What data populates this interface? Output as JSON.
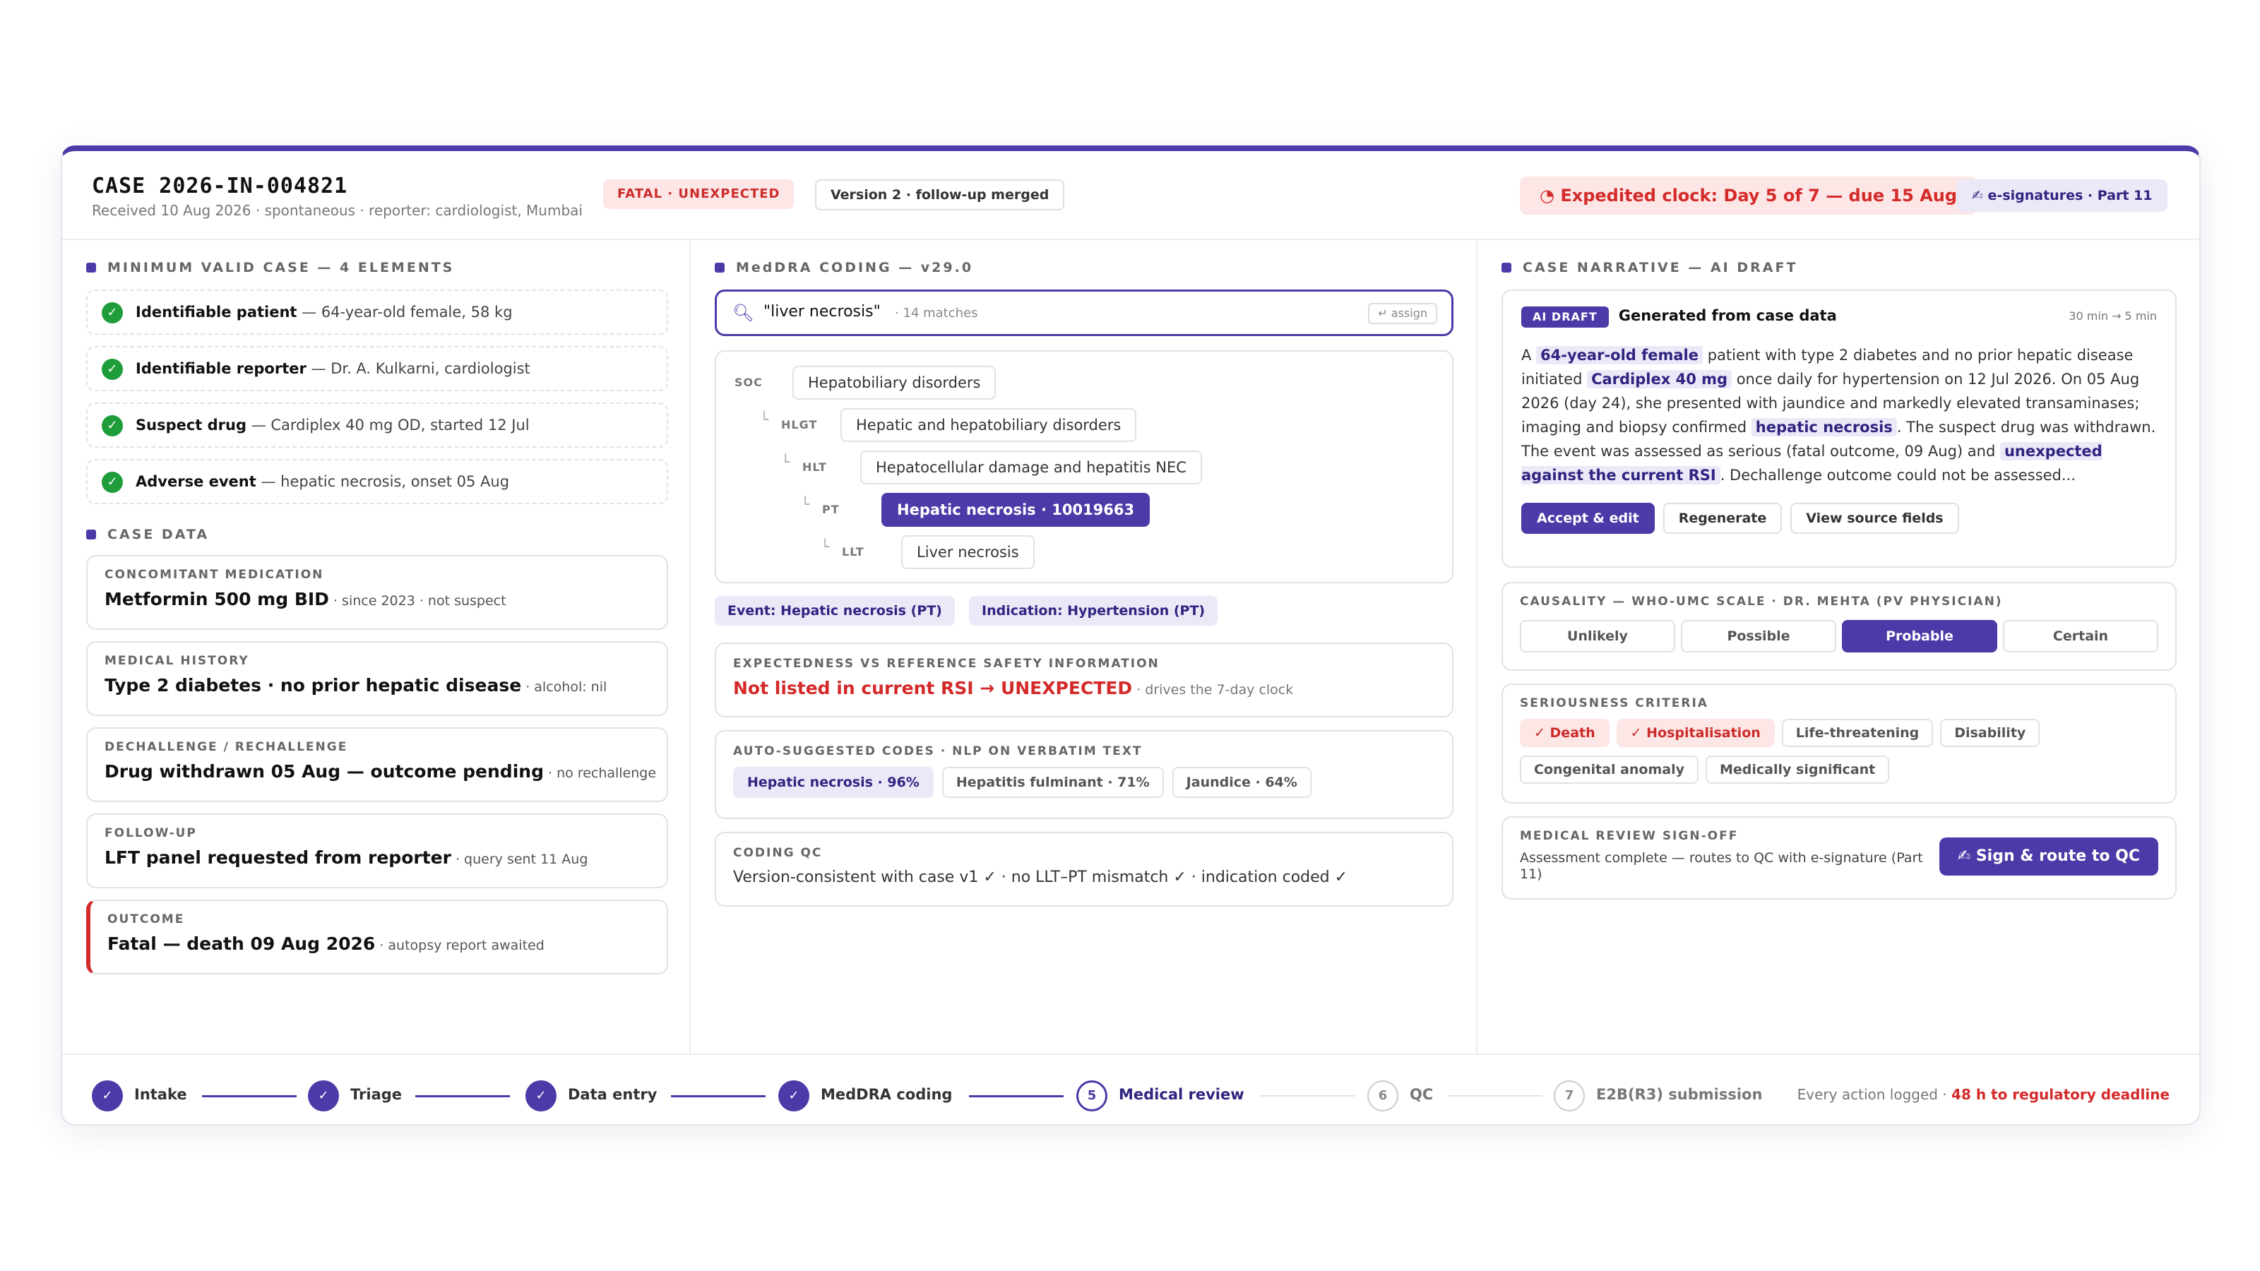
{
  "header": {
    "case_id": "CASE 2026-IN-004821",
    "case_sub": "Received 10 Aug 2026 · spontaneous · reporter: cardiologist, Mumbai",
    "badge_fatal": "FATAL · UNEXPECTED",
    "badge_version": "Version 2 · follow-up merged",
    "clock_icon": "◔",
    "clock_text": "Expedited clock: Day 5 of 7 — due 15 Aug",
    "esig_icon": "✍",
    "esig_text": "e-signatures · Part 11"
  },
  "mvc": {
    "title": "MINIMUM VALID CASE — 4 ELEMENTS",
    "items": [
      {
        "label": "Identifiable patient",
        "detail": " — 64-year-old female, 58 kg"
      },
      {
        "label": "Identifiable reporter",
        "detail": " — Dr. A. Kulkarni, cardiologist"
      },
      {
        "label": "Suspect drug",
        "detail": " — Cardiplex 40 mg OD, started 12 Jul"
      },
      {
        "label": "Adverse event",
        "detail": " — hepatic necrosis, onset 05 Aug"
      }
    ]
  },
  "case_data": {
    "title": "CASE DATA",
    "cards": [
      {
        "label": "CONCOMITANT MEDICATION",
        "value": "Metformin 500 mg BID",
        "note": " · since 2023 · not suspect"
      },
      {
        "label": "MEDICAL HISTORY",
        "value": "Type 2 diabetes · no prior hepatic disease",
        "note": " · alcohol: nil"
      },
      {
        "label": "DECHALLENGE / RECHALLENGE",
        "value": "Drug withdrawn 05 Aug — outcome pending",
        "note": " · no rechallenge"
      },
      {
        "label": "FOLLOW-UP",
        "value": "LFT panel requested from reporter",
        "note": " · query sent 11 Aug"
      },
      {
        "label": "OUTCOME",
        "value": "Fatal — death 09 Aug 2026",
        "note": " · autopsy report awaited"
      }
    ]
  },
  "meddra": {
    "title": "MedDRA CODING — v29.0",
    "search_query": "\"liver necrosis\"",
    "search_count": "· 14 matches",
    "assign_label": "↵ assign",
    "tree": [
      {
        "level": "SOC",
        "term": "Hepatobiliary disorders"
      },
      {
        "level": "HLGT",
        "term": "Hepatic and hepatobiliary disorders"
      },
      {
        "level": "HLT",
        "term": "Hepatocellular damage and hepatitis NEC"
      },
      {
        "level": "PT",
        "term": "Hepatic necrosis · 10019663"
      },
      {
        "level": "LLT",
        "term": "Liver necrosis"
      }
    ],
    "chips": [
      "Event: Hepatic necrosis (PT)",
      "Indication: Hypertension (PT)"
    ],
    "expectedness": {
      "label": "EXPECTEDNESS VS REFERENCE SAFETY INFORMATION",
      "value": "Not listed in current RSI → UNEXPECTED",
      "note": " · drives the 7-day clock"
    },
    "auto": {
      "label": "AUTO-SUGGESTED CODES · NLP ON VERBATIM TEXT",
      "items": [
        "Hepatic necrosis · 96%",
        "Hepatitis fulminant · 71%",
        "Jaundice · 64%"
      ]
    },
    "qc": {
      "label": "CODING QC",
      "text": "Version-consistent with case v1 ✓ · no LLT–PT mismatch ✓ · indication coded ✓"
    }
  },
  "narrative": {
    "title": "CASE NARRATIVE — AI DRAFT",
    "badge": "AI DRAFT",
    "heading": "Generated from case data",
    "time": "30 min → 5 min",
    "parts": [
      "A ",
      "64-year-old female",
      " patient with type 2 diabetes and no prior hepatic disease initiated ",
      "Cardiplex 40 mg",
      " once daily for hypertension on 12 Jul 2026. On 05 Aug 2026 (day 24), she presented with jaundice and markedly elevated transaminases; imaging and biopsy confirmed ",
      "hepatic necrosis",
      ". The suspect drug was withdrawn. The event was assessed as serious (fatal outcome, 09 Aug) and ",
      "unexpected against the current RSI",
      ". Dechallenge outcome could not be assessed..."
    ],
    "buttons": [
      "Accept & edit",
      "Regenerate",
      "View source fields"
    ]
  },
  "causality": {
    "label": "CAUSALITY — WHO-UMC SCALE · DR. MEHTA (PV PHYSICIAN)",
    "options": [
      "Unlikely",
      "Possible",
      "Probable",
      "Certain"
    ],
    "selected": "Probable"
  },
  "seriousness": {
    "label": "SERIOUSNESS CRITERIA",
    "items": [
      "✓ Death",
      "✓ Hospitalisation",
      "Life-threatening",
      "Disability",
      "Congenital anomaly",
      "Medically significant"
    ]
  },
  "signoff": {
    "label": "MEDICAL REVIEW SIGN-OFF",
    "text": "Assessment complete — routes to QC with e-signature (Part 11)",
    "button": "✍ Sign & route to QC"
  },
  "workflow": {
    "steps": [
      {
        "mark": "✓",
        "name": "Intake"
      },
      {
        "mark": "✓",
        "name": "Triage"
      },
      {
        "mark": "✓",
        "name": "Data entry"
      },
      {
        "mark": "✓",
        "name": "MedDRA coding"
      },
      {
        "mark": "5",
        "name": "Medical review"
      },
      {
        "mark": "6",
        "name": "QC"
      },
      {
        "mark": "7",
        "name": "E2B(R3) submission"
      }
    ],
    "note_prefix": "Every action logged · ",
    "note_deadline": "48 h to regulatory deadline"
  },
  "colors": {
    "accent": "#4b3aa7",
    "danger": "#d42a2a",
    "success": "#1f9d3a"
  }
}
